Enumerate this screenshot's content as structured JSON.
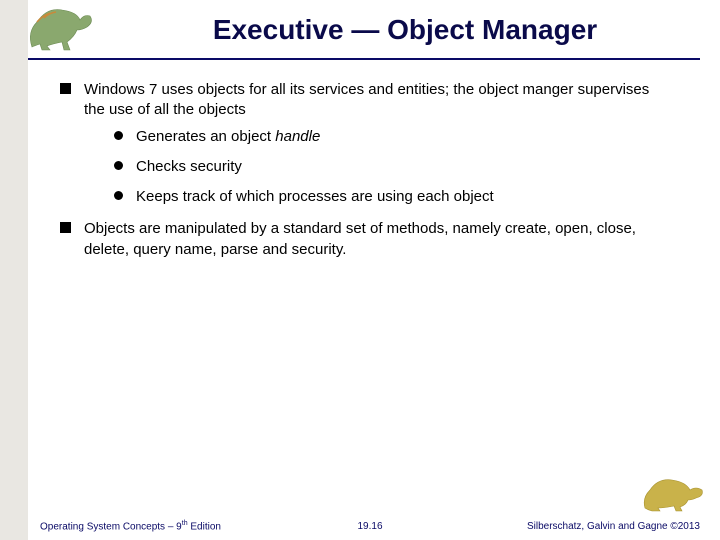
{
  "title": "Executive — Object Manager",
  "bullets": [
    {
      "text": "Windows 7 uses objects for all its services and entities; the object manger supervises the use of all the objects",
      "sub": [
        {
          "pre": "Generates an object ",
          "italic": "handle"
        },
        {
          "pre": "Checks security"
        },
        {
          "pre": "Keeps track of which processes are using each object"
        }
      ]
    },
    {
      "text": "Objects are manipulated by a standard set of methods, namely create, open, close, delete, query name, parse and security."
    }
  ],
  "footer": {
    "left_pre": "Operating System Concepts – 9",
    "left_sup": "th",
    "left_post": " Edition",
    "center": "19.16",
    "right": "Silberschatz, Galvin and Gagne ©2013"
  }
}
